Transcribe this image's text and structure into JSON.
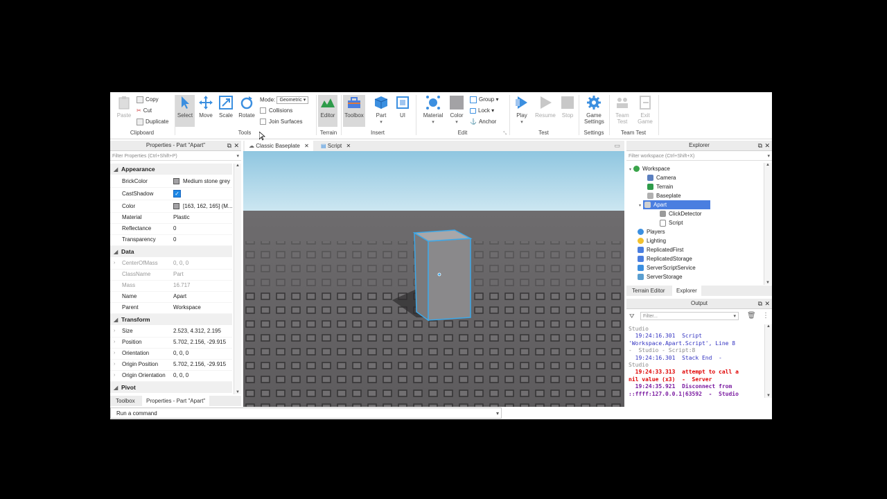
{
  "ribbon": {
    "clipboard": {
      "paste": "Paste",
      "copy": "Copy",
      "cut": "Cut",
      "duplicate": "Duplicate",
      "label": "Clipboard"
    },
    "tools": {
      "select": "Select",
      "move": "Move",
      "scale": "Scale",
      "rotate": "Rotate",
      "mode_label": "Mode:",
      "mode_value": "Geometric",
      "collisions": "Collisions",
      "join_surfaces": "Join Surfaces",
      "label": "Tools"
    },
    "terrain": {
      "editor": "Editor",
      "label": "Terrain"
    },
    "insert": {
      "toolbox": "Toolbox",
      "part": "Part",
      "ui": "UI",
      "label": "Insert"
    },
    "edit": {
      "material": "Material",
      "color": "Color",
      "group": "Group",
      "lock": "Lock",
      "anchor": "Anchor",
      "label": "Edit"
    },
    "test": {
      "play": "Play",
      "resume": "Resume",
      "stop": "Stop",
      "label": "Test"
    },
    "settings": {
      "game_settings_1": "Game",
      "game_settings_2": "Settings",
      "label": "Settings"
    },
    "team_test": {
      "team_test_1": "Team",
      "team_test_2": "Test",
      "exit_game_1": "Exit",
      "exit_game_2": "Game",
      "label": "Team Test"
    }
  },
  "properties": {
    "title": "Properties - Part \"Apart\"",
    "filter_placeholder": "Filter Properties (Ctrl+Shift+P)",
    "appearance": {
      "header": "Appearance",
      "brickcolor_name": "BrickColor",
      "brickcolor_value": "Medium stone grey",
      "castshadow_name": "CastShadow",
      "color_name": "Color",
      "color_value": "[163, 162, 165] (M...",
      "material_name": "Material",
      "material_value": "Plastic",
      "reflectance_name": "Reflectance",
      "reflectance_value": "0",
      "transparency_name": "Transparency",
      "transparency_value": "0"
    },
    "data": {
      "header": "Data",
      "centerofmass_name": "CenterOfMass",
      "centerofmass_value": "0, 0, 0",
      "classname_name": "ClassName",
      "classname_value": "Part",
      "mass_name": "Mass",
      "mass_value": "16.717",
      "name_name": "Name",
      "name_value": "Apart",
      "parent_name": "Parent",
      "parent_value": "Workspace"
    },
    "transform": {
      "header": "Transform",
      "size_name": "Size",
      "size_value": "2.523, 4.312, 2.195",
      "position_name": "Position",
      "position_value": "5.702, 2.156, -29.915",
      "orientation_name": "Orientation",
      "orientation_value": "0, 0, 0",
      "originposition_name": "Origin Position",
      "originposition_value": "5.702, 2.156, -29.915",
      "originorientation_name": "Origin Orientation",
      "originorientation_value": "0, 0, 0"
    },
    "pivot": {
      "header": "Pivot"
    }
  },
  "bottom_tabs": {
    "toolbox": "Toolbox",
    "properties": "Properties - Part \"Apart\""
  },
  "doc_tabs": {
    "baseplate": "Classic Baseplate",
    "script": "Script"
  },
  "explorer": {
    "title": "Explorer",
    "filter_placeholder": "Filter workspace (Ctrl+Shift+X)",
    "items": [
      "Workspace",
      "Camera",
      "Terrain",
      "Baseplate",
      "Apart",
      "ClickDetector",
      "Script",
      "Players",
      "Lighting",
      "ReplicatedFirst",
      "ReplicatedStorage",
      "ServerScriptService",
      "ServerStorage"
    ],
    "tab_terrain": "Terrain Editor",
    "tab_explorer": "Explorer"
  },
  "output": {
    "title": "Output",
    "filter_placeholder": "Filter...",
    "lines": [
      "Studio",
      "  19:24:16.301  Script",
      "'Workspace.Apart.Script', Line 8",
      "-  Studio - Script:8",
      "  19:24:16.301  Stack End  -",
      "Studio",
      "  19:24:33.313  attempt to call a",
      "nil value (x3)  -  Server",
      "  19:24:35.921  Disconnect from",
      "::ffff:127.0.0.1|63592  -  Studio"
    ]
  },
  "command_bar": {
    "placeholder": "Run a command"
  },
  "colors": {
    "accent": "#1e88e5",
    "selection": "#4a7ee0",
    "error": "#e00000",
    "info": "#3030c0"
  }
}
